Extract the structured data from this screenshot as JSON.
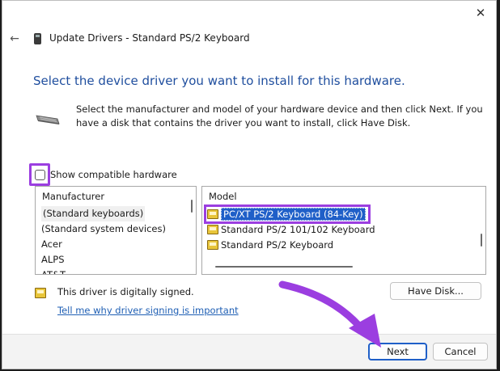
{
  "window": {
    "title": "Update Drivers - Standard PS/2 Keyboard",
    "close_symbol": "✕",
    "back_symbol": "←"
  },
  "heading": "Select the device driver you want to install for this hardware.",
  "description": "Select the manufacturer and model of your hardware device and then click Next. If you have a disk that contains the driver you want to install, click Have Disk.",
  "compatible_checkbox": {
    "label": "Show compatible hardware",
    "checked": false
  },
  "manufacturer": {
    "header": "Manufacturer",
    "items": [
      "(Standard keyboards)",
      "(Standard system devices)",
      "Acer",
      "ALPS",
      "AT&T"
    ],
    "selected": "(Standard keyboards)"
  },
  "model": {
    "header": "Model",
    "items": [
      "PC/XT PS/2 Keyboard (84-Key)",
      "Standard PS/2 101/102 Keyboard",
      "Standard PS/2 Keyboard"
    ],
    "selected": "PC/XT PS/2 Keyboard (84-Key)"
  },
  "signed_text": "This driver is digitally signed.",
  "signing_link": "Tell me why driver signing is important",
  "buttons": {
    "have_disk": "Have Disk...",
    "next": "Next",
    "cancel": "Cancel"
  },
  "icons": {
    "window": "device-icon",
    "keyboard": "keyboard-icon",
    "driver": "driver-icon",
    "signed": "certificate-icon"
  },
  "colors": {
    "heading": "#1f4e9e",
    "selection": "#1f5fc8",
    "highlight_annotation": "#9b3ee0",
    "link": "#1f5fb4"
  }
}
